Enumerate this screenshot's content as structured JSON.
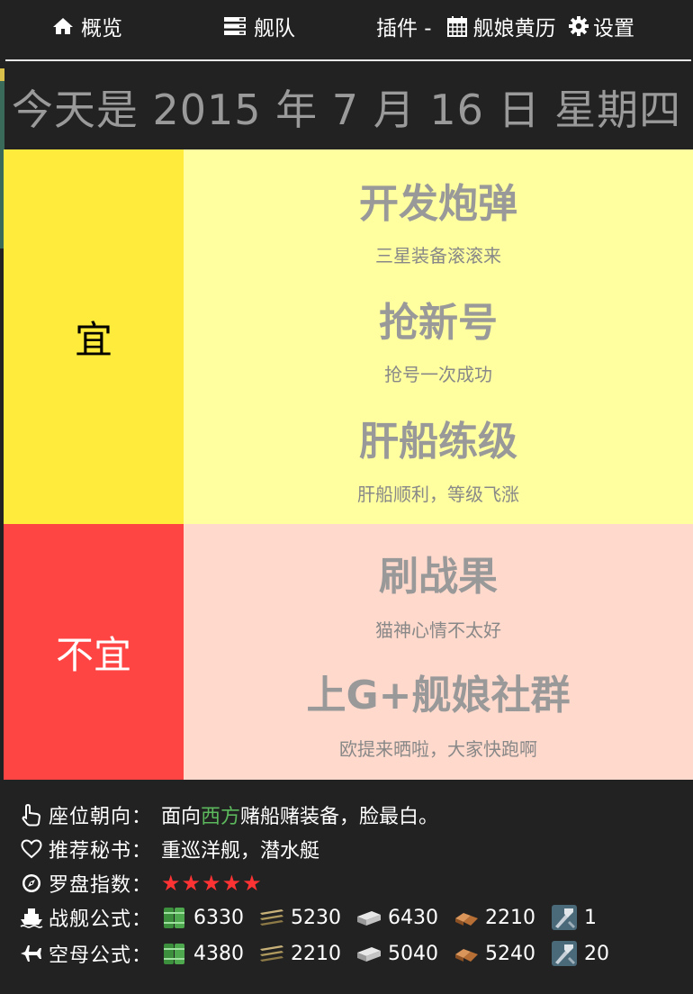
{
  "nav": {
    "overview": "概览",
    "fleet": "舰队",
    "plugin_prefix": "插件 -",
    "calendar": "舰娘黄历",
    "settings": "设置"
  },
  "date_title": "今天是 2015 年 7 月 16 日 星期四",
  "good": {
    "label": "宜",
    "items": [
      {
        "title": "开发炮弹",
        "desc": "三星装备滚滚来"
      },
      {
        "title": "抢新号",
        "desc": "抢号一次成功"
      },
      {
        "title": "肝船练级",
        "desc": "肝船顺利，等级飞涨"
      }
    ]
  },
  "bad": {
    "label": "不宜",
    "items": [
      {
        "title": "刷战果",
        "desc": "猫神心情不太好"
      },
      {
        "title": "上G+舰娘社群",
        "desc": "欧提来晒啦，大家快跑啊"
      }
    ]
  },
  "info": {
    "seat_label": "座位朝向：",
    "seat_prefix": "面向",
    "seat_direction": "西方",
    "seat_suffix": "赌船赌装备，脸最白。",
    "secretary_label": "推荐秘书：",
    "secretary_value": "重巡洋舰，潜水艇",
    "compass_label": "罗盘指数：",
    "compass_stars": "★★★★★",
    "battleship_label": "战舰公式：",
    "battleship": {
      "fuel": "6330",
      "ammo": "5230",
      "steel": "6430",
      "bauxite": "2210",
      "devmat": "1"
    },
    "carrier_label": "空母公式：",
    "carrier": {
      "fuel": "4380",
      "ammo": "2210",
      "steel": "5040",
      "bauxite": "5240",
      "devmat": "20"
    }
  },
  "colors": {
    "good_label_bg": "#ffeb3b",
    "good_content_bg": "#ffffa0",
    "bad_label_bg": "#ff4444",
    "bad_content_bg": "#ffd9cc",
    "direction_green": "#5cb85c",
    "star_red": "#ff3333"
  }
}
